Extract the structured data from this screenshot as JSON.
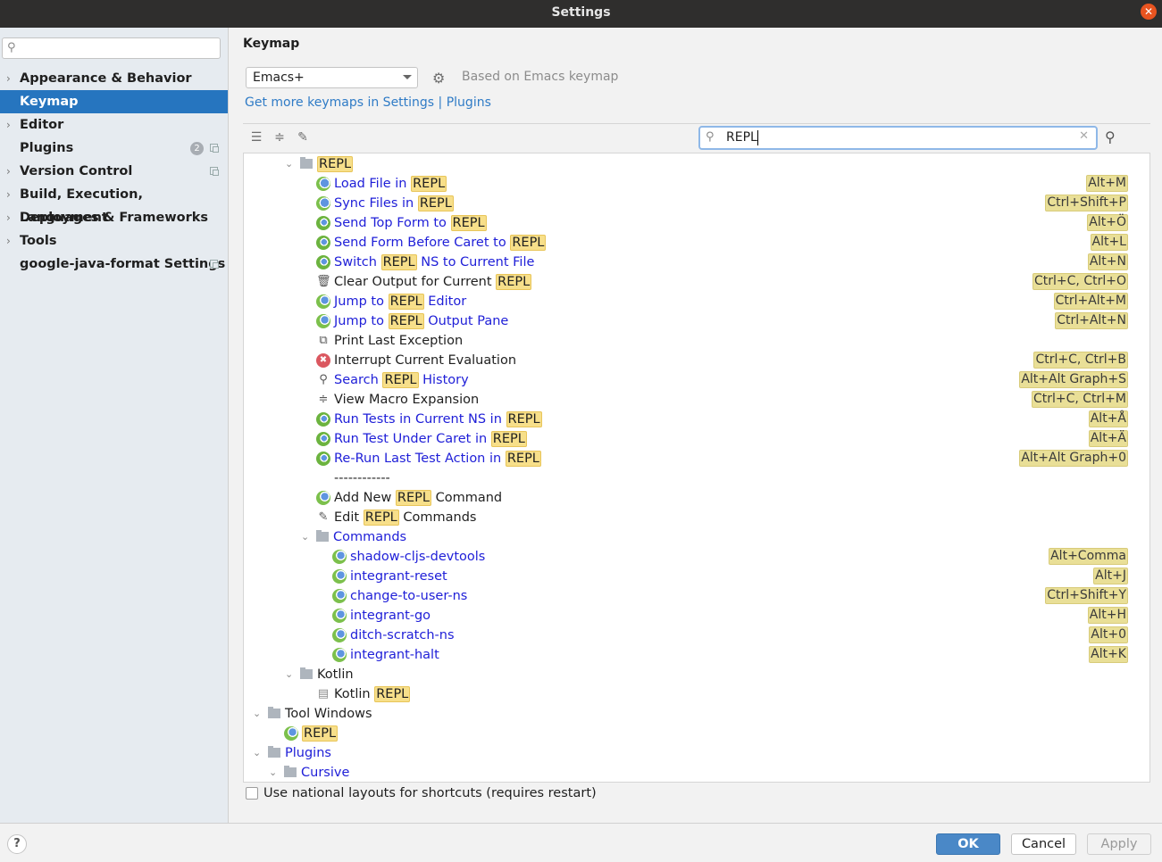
{
  "window": {
    "title": "Settings"
  },
  "sidebar": {
    "search_placeholder": "",
    "items": [
      {
        "label": "Appearance & Behavior",
        "expandable": true,
        "selected": false
      },
      {
        "label": "Keymap",
        "expandable": false,
        "selected": true
      },
      {
        "label": "Editor",
        "expandable": true,
        "selected": false
      },
      {
        "label": "Plugins",
        "expandable": false,
        "selected": false,
        "badge": "2",
        "project_icon": true
      },
      {
        "label": "Version Control",
        "expandable": true,
        "selected": false,
        "project_icon": true
      },
      {
        "label": "Build, Execution, Deployment",
        "expandable": true,
        "selected": false
      },
      {
        "label": "Languages & Frameworks",
        "expandable": true,
        "selected": false
      },
      {
        "label": "Tools",
        "expandable": true,
        "selected": false
      },
      {
        "label": "google-java-format Settings",
        "expandable": false,
        "selected": false,
        "project_icon": true
      }
    ]
  },
  "keymap": {
    "title": "Keymap",
    "selected_keymap": "Emacs+",
    "based_on": "Based on Emacs keymap",
    "more_link": "Get more keymaps in Settings | Plugins",
    "filter_value": "REPL",
    "use_national_layouts": "Use national layouts for shortcuts (requires restart)",
    "use_national_layouts_checked": false
  },
  "tree": [
    {
      "indent": 2,
      "type": "folder",
      "expanded": true,
      "parts": [
        {
          "t": "REPL",
          "h": true
        }
      ],
      "color": "black"
    },
    {
      "indent": 3,
      "icon": "cljs-load-icon",
      "parts": [
        {
          "t": "Load File in "
        },
        {
          "t": "REPL",
          "h": true
        }
      ],
      "color": "blue",
      "shortcut": "Alt+M"
    },
    {
      "indent": 3,
      "icon": "cljs-load-icon",
      "parts": [
        {
          "t": "Sync Files in "
        },
        {
          "t": "REPL",
          "h": true
        }
      ],
      "color": "blue",
      "shortcut": "Ctrl+Shift+P"
    },
    {
      "indent": 3,
      "icon": "cljs-run-icon",
      "parts": [
        {
          "t": "Send Top Form to "
        },
        {
          "t": "REPL",
          "h": true
        }
      ],
      "color": "blue",
      "shortcut": "Alt+Ö"
    },
    {
      "indent": 3,
      "icon": "cljs-run-icon",
      "parts": [
        {
          "t": "Send Form Before Caret to "
        },
        {
          "t": "REPL",
          "h": true
        }
      ],
      "color": "blue",
      "shortcut": "Alt+L"
    },
    {
      "indent": 3,
      "icon": "cljs-run-icon",
      "parts": [
        {
          "t": "Switch "
        },
        {
          "t": "REPL",
          "h": true
        },
        {
          "t": " NS to Current File"
        }
      ],
      "color": "blue",
      "shortcut": "Alt+N"
    },
    {
      "indent": 3,
      "icon": "trash-icon",
      "parts": [
        {
          "t": "Clear Output for Current "
        },
        {
          "t": "REPL",
          "h": true
        }
      ],
      "color": "black",
      "shortcut": "Ctrl+C, Ctrl+O"
    },
    {
      "indent": 3,
      "icon": "cljs-icon",
      "parts": [
        {
          "t": "Jump to "
        },
        {
          "t": "REPL",
          "h": true
        },
        {
          "t": " Editor"
        }
      ],
      "color": "blue",
      "shortcut": "Ctrl+Alt+M"
    },
    {
      "indent": 3,
      "icon": "cljs-icon",
      "parts": [
        {
          "t": "Jump to "
        },
        {
          "t": "REPL",
          "h": true
        },
        {
          "t": " Output Pane"
        }
      ],
      "color": "blue",
      "shortcut": "Ctrl+Alt+N"
    },
    {
      "indent": 3,
      "icon": "copy-icon",
      "parts": [
        {
          "t": "Print Last Exception"
        }
      ],
      "color": "black"
    },
    {
      "indent": 3,
      "icon": "stop-icon",
      "parts": [
        {
          "t": "Interrupt Current Evaluation"
        }
      ],
      "color": "black",
      "shortcut": "Ctrl+C, Ctrl+B"
    },
    {
      "indent": 3,
      "icon": "search-icon",
      "parts": [
        {
          "t": "Search "
        },
        {
          "t": "REPL",
          "h": true
        },
        {
          "t": " History"
        }
      ],
      "color": "blue",
      "shortcut": "Alt+Alt Graph+S"
    },
    {
      "indent": 3,
      "icon": "expand-icon",
      "parts": [
        {
          "t": "View Macro Expansion"
        }
      ],
      "color": "black",
      "shortcut": "Ctrl+C, Ctrl+M"
    },
    {
      "indent": 3,
      "icon": "cljs-test-icon",
      "parts": [
        {
          "t": "Run Tests in Current NS in "
        },
        {
          "t": "REPL",
          "h": true
        }
      ],
      "color": "blue",
      "shortcut": "Alt+Å"
    },
    {
      "indent": 3,
      "icon": "cljs-test-icon",
      "parts": [
        {
          "t": "Run Test Under Caret in "
        },
        {
          "t": "REPL",
          "h": true
        }
      ],
      "color": "blue",
      "shortcut": "Alt+Ä"
    },
    {
      "indent": 3,
      "icon": "cljs-test-icon",
      "parts": [
        {
          "t": "Re-Run Last Test Action in "
        },
        {
          "t": "REPL",
          "h": true
        }
      ],
      "color": "blue",
      "shortcut": "Alt+Alt Graph+0"
    },
    {
      "indent": 3,
      "icon": "none",
      "parts": [
        {
          "t": "------------"
        }
      ],
      "color": "black"
    },
    {
      "indent": 3,
      "icon": "cljs-icon",
      "parts": [
        {
          "t": "Add New "
        },
        {
          "t": "REPL",
          "h": true
        },
        {
          "t": " Command"
        }
      ],
      "color": "black"
    },
    {
      "indent": 3,
      "icon": "edit-icon",
      "parts": [
        {
          "t": "Edit "
        },
        {
          "t": "REPL",
          "h": true
        },
        {
          "t": " Commands"
        }
      ],
      "color": "black"
    },
    {
      "indent": 3,
      "type": "folder",
      "expanded": true,
      "parts": [
        {
          "t": "Commands"
        }
      ],
      "color": "blue"
    },
    {
      "indent": 4,
      "icon": "cljs-icon",
      "parts": [
        {
          "t": "shadow-cljs-devtools"
        }
      ],
      "color": "blue",
      "shortcut": "Alt+Comma"
    },
    {
      "indent": 4,
      "icon": "cljs-icon",
      "parts": [
        {
          "t": "integrant-reset"
        }
      ],
      "color": "blue",
      "shortcut": "Alt+J"
    },
    {
      "indent": 4,
      "icon": "cljs-icon",
      "parts": [
        {
          "t": "change-to-user-ns"
        }
      ],
      "color": "blue",
      "shortcut": "Ctrl+Shift+Y"
    },
    {
      "indent": 4,
      "icon": "cljs-icon",
      "parts": [
        {
          "t": "integrant-go"
        }
      ],
      "color": "blue",
      "shortcut": "Alt+H"
    },
    {
      "indent": 4,
      "icon": "cljs-icon",
      "parts": [
        {
          "t": "ditch-scratch-ns"
        }
      ],
      "color": "blue",
      "shortcut": "Alt+0"
    },
    {
      "indent": 4,
      "icon": "cljs-icon",
      "parts": [
        {
          "t": "integrant-halt"
        }
      ],
      "color": "blue",
      "shortcut": "Alt+K"
    },
    {
      "indent": 2,
      "type": "folder",
      "expanded": true,
      "parts": [
        {
          "t": "Kotlin"
        }
      ],
      "color": "black"
    },
    {
      "indent": 3,
      "icon": "kotlin-icon",
      "parts": [
        {
          "t": "Kotlin "
        },
        {
          "t": "REPL",
          "h": true
        }
      ],
      "color": "black"
    },
    {
      "indent": 0,
      "type": "folder",
      "expanded": true,
      "parts": [
        {
          "t": "Tool Windows"
        }
      ],
      "color": "black"
    },
    {
      "indent": 1,
      "icon": "cljs-icon",
      "parts": [
        {
          "t": "REPL",
          "h": true
        }
      ],
      "color": "black"
    },
    {
      "indent": 0,
      "type": "folder",
      "expanded": true,
      "parts": [
        {
          "t": "Plugins"
        }
      ],
      "color": "blue"
    },
    {
      "indent": 1,
      "type": "folder",
      "expanded": true,
      "parts": [
        {
          "t": "Cursive"
        }
      ],
      "color": "blue"
    }
  ],
  "footer": {
    "help": "?",
    "ok": "OK",
    "cancel": "Cancel",
    "apply": "Apply"
  },
  "icons": {
    "close": "✕",
    "gear": "⚙",
    "search": "⚲",
    "clear": "✕",
    "chevron_right": "›",
    "chevron_down": "⌄"
  }
}
